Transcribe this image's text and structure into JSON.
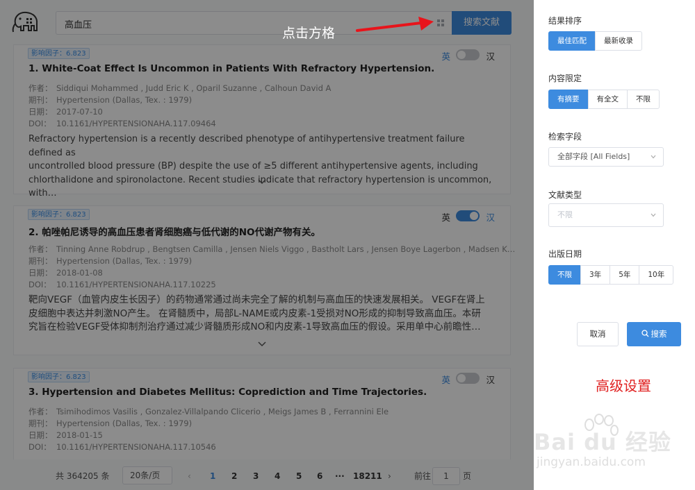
{
  "search": {
    "query": "高血压",
    "button_label": "搜索文献"
  },
  "results": [
    {
      "impact": "影响因子：6.823",
      "title": "1. White-Coat Effect Is Uncommon in Patients With Refractory Hypertension.",
      "author_label": "作者：",
      "authors": "Siddiqui Mohammed , Judd Eric K , Oparil Suzanne , Calhoun David A",
      "journal_label": "期刊：",
      "journal": "Hypertension (Dallas, Tex. : 1979)",
      "date_label": "日期：",
      "date": "2017-07-10",
      "doi_label": "DOI：",
      "doi": "10.1161/HYPERTENSIONAHA.117.09464",
      "abstract_lines": [
        "Refractory hypertension is a recently described phenotype of antihypertensive treatment failure defined as",
        "uncontrolled blood pressure (BP) despite the use of ≥5 different antihypertensive agents, including",
        "chlorthalidone and spironolactone. Recent studies indicate that refractory hypertension is uncommon, with…"
      ],
      "lang_en": "英",
      "lang_zh": "汉",
      "translate_on": false
    },
    {
      "impact": "影响因子：6.823",
      "title": "2. 帕唑帕尼诱导的高血压患者肾细胞癌与低代谢的NO代谢产物有关。",
      "author_label": "作者：",
      "authors": "Tinning Anne Robdrup , Bengtsen Camilla , Jensen Niels Viggo , Bastholt Lars , Jensen Boye Lagerbon , Madsen K…",
      "journal_label": "期刊：",
      "journal": "Hypertension (Dallas, Tex. : 1979)",
      "date_label": "日期：",
      "date": "2018-01-08",
      "doi_label": "DOI：",
      "doi": "10.1161/HYPERTENSIONAHA.117.10225",
      "abstract_lines": [
        "靶向VEGF（血管内皮生长因子）的药物通常通过尚未完全了解的机制与高血压的快速发展相关。 VEGF在肾上",
        "皮细胞中表达并刺激NO产生。 在肾髓质中，局部L-NAME或内皮素-1受损对NO形成的抑制导致高血压。本研",
        "究旨在检验VEGF受体抑制剂治疗通过减少肾髓质形成NO和内皮素-1导致高血压的假设。采用单中心前瞻性…"
      ],
      "lang_en": "英",
      "lang_zh": "汉",
      "translate_on": true
    },
    {
      "impact": "影响因子：6.823",
      "title": "3. Hypertension and Diabetes Mellitus: Coprediction and Time Trajectories.",
      "author_label": "作者：",
      "authors": "Tsimihodimos Vasilis , Gonzalez-Villalpando Clicerio , Meigs James B , Ferrannini Ele",
      "journal_label": "期刊：",
      "journal": "Hypertension (Dallas, Tex. : 1979)",
      "date_label": "日期：",
      "date": "2018-01-15",
      "doi_label": "DOI：",
      "doi": "10.1161/HYPERTENSIONAHA.117.10546",
      "abstract_lines": [],
      "lang_en": "英",
      "lang_zh": "汉",
      "translate_on": false
    }
  ],
  "pagination": {
    "total": "共 364205 条",
    "page_size": "20条/页",
    "pages": [
      "1",
      "2",
      "3",
      "4",
      "5",
      "6"
    ],
    "ellipsis": "···",
    "last": "18211",
    "jump_label": "前往",
    "jump_value": "1",
    "jump_suffix": "页",
    "current": "1"
  },
  "drawer": {
    "sort": {
      "label": "结果排序",
      "options": [
        "最佳匹配",
        "最新收录"
      ],
      "selected": 0
    },
    "content": {
      "label": "内容限定",
      "options": [
        "有摘要",
        "有全文",
        "不限"
      ],
      "selected": 0
    },
    "field": {
      "label": "检索字段",
      "value": "全部字段 [All Fields]"
    },
    "doc_type": {
      "label": "文献类型",
      "placeholder": "不限"
    },
    "pub_date": {
      "label": "出版日期",
      "options": [
        "不限",
        "3年",
        "5年",
        "10年"
      ],
      "selected": 0
    },
    "cancel_label": "取消",
    "search_label": "搜索"
  },
  "annotations": {
    "click_grid": "点击方格",
    "advanced": "高级设置"
  },
  "watermark": {
    "brand": "Bai du 经验",
    "url": "jingyan.baidu.com"
  },
  "colors": {
    "accent": "#3d8bdf",
    "annotation_red": "#e02020"
  }
}
